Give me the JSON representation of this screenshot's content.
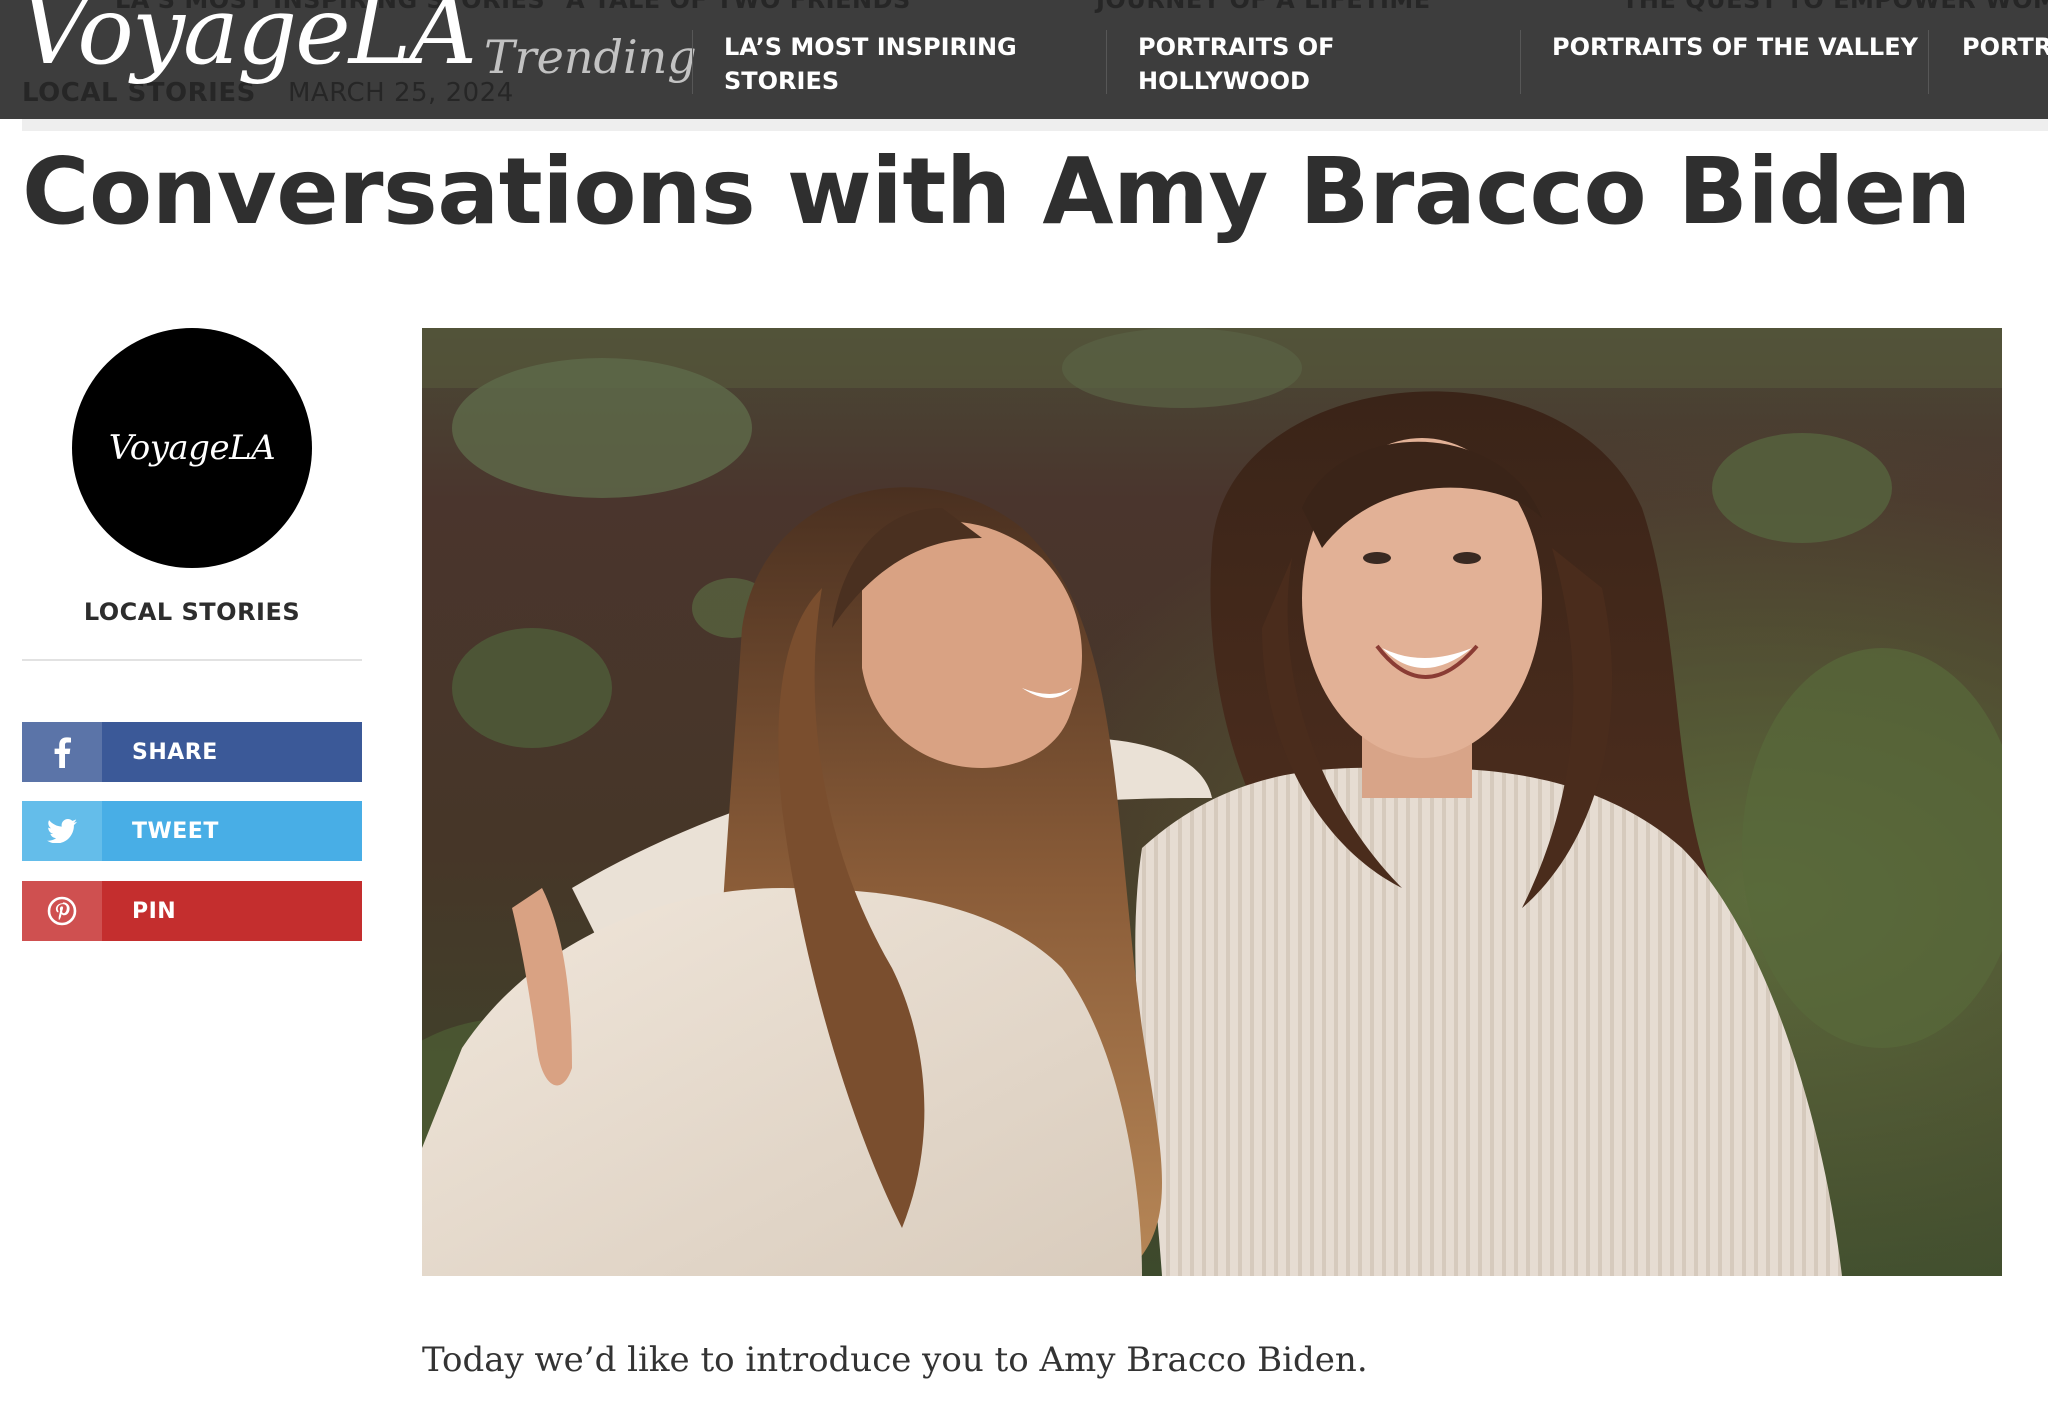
{
  "header": {
    "brand": "VoyageLA",
    "trending_label": "Trending",
    "ghost_row_top": [
      "LA's Most Inspiring Stories",
      "A Tale of Two Friends",
      "Journey of a Lifetime",
      "The Quest to Empower Wome"
    ],
    "ghost_row_bottom": [
      "Local Stories",
      "March 25, 2024"
    ],
    "nav": [
      {
        "line1": "LA’S MOST INSPIRING",
        "line2": "STORIES"
      },
      {
        "line1": "PORTRAITS OF",
        "line2": "HOLLYWOOD"
      },
      {
        "line1": "PORTRAITS OF THE VALLEY",
        "line2": ""
      },
      {
        "line1": "PORTR",
        "line2": ""
      }
    ]
  },
  "article": {
    "title": "Conversations with Amy Bracco Biden",
    "intro": "Today we’d like to introduce you to Amy Bracco Biden.",
    "hero_image_icon": "photo-two-women-smiling"
  },
  "sidebar": {
    "avatar_text": "VoyageLA",
    "category": "LOCAL STORIES",
    "share": [
      {
        "label": "SHARE",
        "icon": "facebook-icon",
        "color": "#3b5998"
      },
      {
        "label": "TWEET",
        "icon": "twitter-icon",
        "color": "#48aee6"
      },
      {
        "label": "PIN",
        "icon": "pinterest-icon",
        "color": "#c42e2e"
      }
    ]
  },
  "colors": {
    "topbar": "#3d3d3d",
    "title": "#2f2f2f"
  }
}
